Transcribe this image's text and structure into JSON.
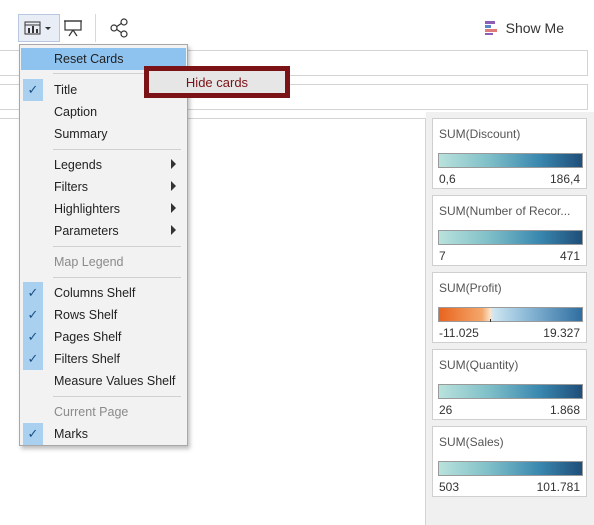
{
  "toolbar": {
    "cards_button_icon": "show-hide-cards-icon",
    "present_icon": "presentation-mode-icon",
    "share_icon": "share-icon",
    "show_me": {
      "icon": "show-me-icon",
      "label": "Show Me"
    }
  },
  "menu": {
    "items": [
      {
        "label": "Reset Cards",
        "checked": false,
        "submenu": false,
        "disabled": false,
        "highlighted": true
      },
      {
        "label": "Title",
        "checked": true,
        "submenu": false,
        "disabled": false
      },
      {
        "label": "Caption",
        "checked": false,
        "submenu": false,
        "disabled": false
      },
      {
        "label": "Summary",
        "checked": false,
        "submenu": false,
        "disabled": false
      },
      {
        "label": "Legends",
        "checked": false,
        "submenu": true,
        "disabled": false
      },
      {
        "label": "Filters",
        "checked": false,
        "submenu": true,
        "disabled": false
      },
      {
        "label": "Highlighters",
        "checked": false,
        "submenu": true,
        "disabled": false
      },
      {
        "label": "Parameters",
        "checked": false,
        "submenu": true,
        "disabled": false
      },
      {
        "label": "Map Legend",
        "checked": false,
        "submenu": false,
        "disabled": true
      },
      {
        "label": "Columns Shelf",
        "checked": true,
        "submenu": false,
        "disabled": false
      },
      {
        "label": "Rows Shelf",
        "checked": true,
        "submenu": false,
        "disabled": false
      },
      {
        "label": "Pages Shelf",
        "checked": true,
        "submenu": false,
        "disabled": false
      },
      {
        "label": "Filters Shelf",
        "checked": true,
        "submenu": false,
        "disabled": false
      },
      {
        "label": "Measure Values Shelf",
        "checked": false,
        "submenu": false,
        "disabled": false
      },
      {
        "label": "Current Page",
        "checked": false,
        "submenu": false,
        "disabled": true
      },
      {
        "label": "Marks",
        "checked": true,
        "submenu": false,
        "disabled": false
      }
    ]
  },
  "tooltip": {
    "text": "Hide cards"
  },
  "legends": [
    {
      "title": "SUM(Discount)",
      "min": "0,6",
      "max": "186,4",
      "palette": "teal-blue"
    },
    {
      "title": "SUM(Number of Recor...",
      "min": "7",
      "max": "471",
      "palette": "teal-blue"
    },
    {
      "title": "SUM(Profit)",
      "min": "-11.025",
      "max": "19.327",
      "palette": "orange-blue-diverging"
    },
    {
      "title": "SUM(Quantity)",
      "min": "26",
      "max": "1.868",
      "palette": "teal-blue"
    },
    {
      "title": "SUM(Sales)",
      "min": "503",
      "max": "101.781",
      "palette": "teal-blue"
    }
  ],
  "colors": {
    "menu_highlight": "#8fc3ef",
    "check_background": "#a9d1ef",
    "tooltip_border": "#7b1216"
  }
}
